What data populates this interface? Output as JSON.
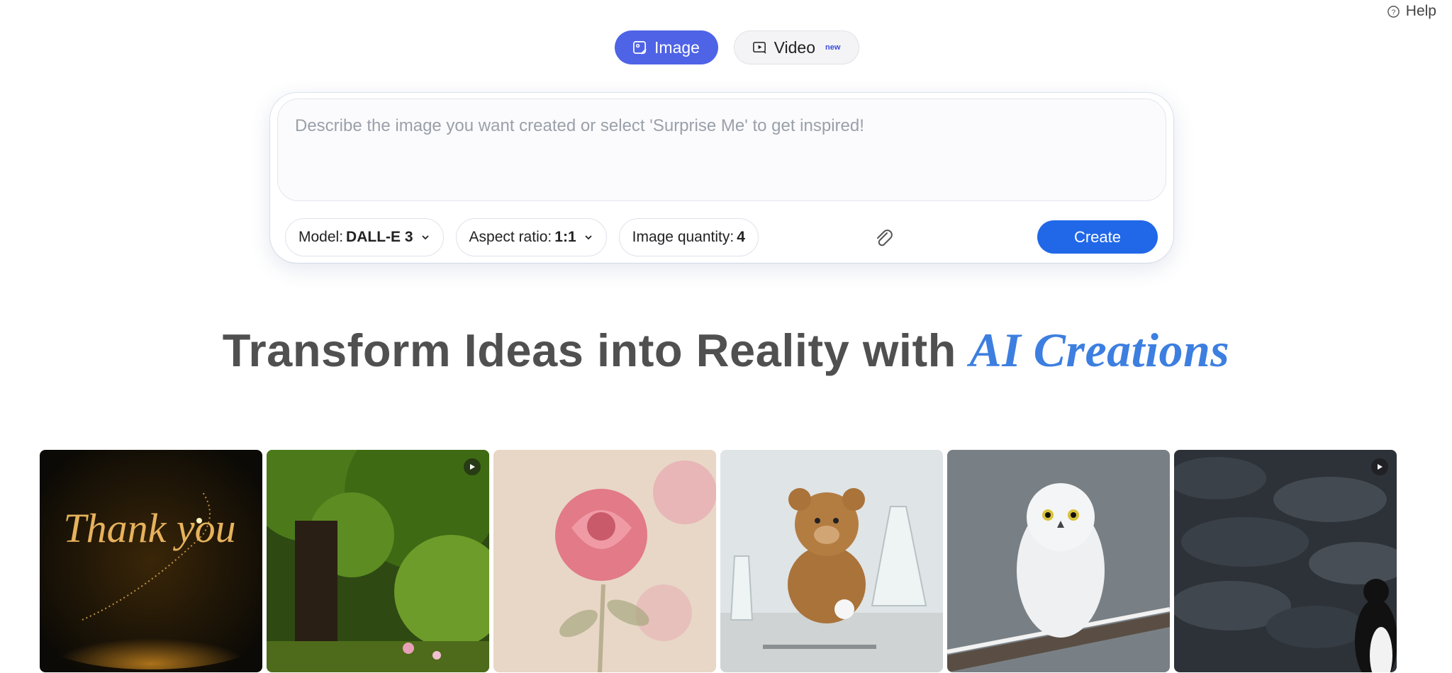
{
  "help": {
    "label": "Help"
  },
  "tabs": [
    {
      "label": "Image",
      "active": true
    },
    {
      "label": "Video",
      "badge": "new",
      "active": false
    }
  ],
  "prompt": {
    "placeholder": "Describe the image you want created or select 'Surprise Me' to get inspired!",
    "value": ""
  },
  "options": {
    "model": {
      "label": "Model:",
      "value": "DALL-E 3"
    },
    "aspect": {
      "label": "Aspect ratio:",
      "value": "1:1"
    },
    "quantity": {
      "label": "Image quantity:",
      "value": "4"
    }
  },
  "create_label": "Create",
  "headline": {
    "text": "Transform Ideas into Reality with ",
    "accent": "AI Creations"
  },
  "colors": {
    "primary": "#4f63e6",
    "create": "#2168e8",
    "accent_text": "#3d7fe0"
  },
  "gallery": [
    {
      "subject": "thank-you-script",
      "text": "Thank you",
      "video": false
    },
    {
      "subject": "forest-tree",
      "video": true
    },
    {
      "subject": "glass-rose",
      "video": false
    },
    {
      "subject": "teddy-bear-lab",
      "video": false
    },
    {
      "subject": "snowy-owl",
      "video": false
    },
    {
      "subject": "penguin-rocks",
      "video": true
    }
  ]
}
